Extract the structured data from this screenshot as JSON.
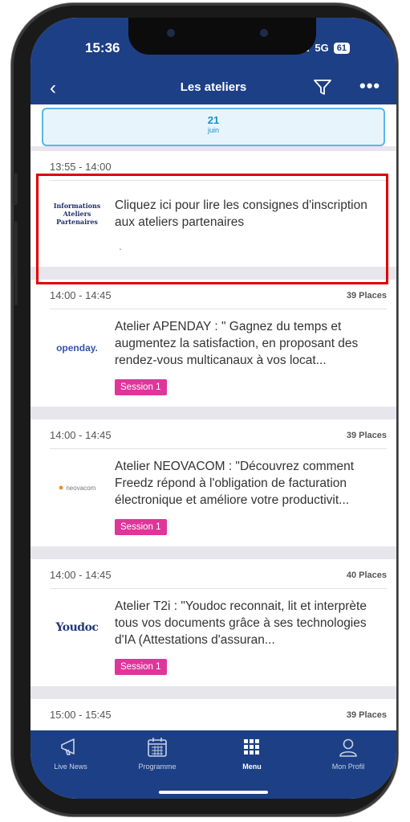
{
  "status": {
    "time": "15:36",
    "network": "5G",
    "battery": "61"
  },
  "nav": {
    "back": "‹",
    "title": "Les ateliers",
    "filter_icon": "filter-icon",
    "more": "•••"
  },
  "date": {
    "day": "21",
    "month": "juin"
  },
  "cards": [
    {
      "time": "13:55 - 14:00",
      "places": "",
      "logo": [
        "Informations",
        "Ateliers",
        "Partenaires"
      ],
      "text": "Cliquez ici pour lire les consignes d'inscription aux ateliers partenaires",
      "extra": ".",
      "badge": ""
    },
    {
      "time": "14:00 - 14:45",
      "places": "39 Places",
      "logo": [
        "openday."
      ],
      "text": "Atelier APENDAY : \" Gagnez du temps et augmentez la satisfaction, en proposant des rendez-vous multicanaux à vos locat...",
      "badge": "Session 1"
    },
    {
      "time": "14:00 - 14:45",
      "places": "39 Places",
      "logo": [
        "neovacom"
      ],
      "text": "Atelier NEOVACOM : \"Découvrez comment Freedz répond à l'obligation de facturation électronique et améliore votre productivit...",
      "badge": "Session 1"
    },
    {
      "time": "14:00 - 14:45",
      "places": "40 Places",
      "logo": [
        "Youdoc"
      ],
      "text": "Atelier T2i : \"Youdoc reconnait, lit et interprète tous vos documents grâce à ses technologies d'IA (Attestations d'assuran...",
      "badge": "Session 1"
    },
    {
      "time": "15:00 - 15:45",
      "places": "39 Places"
    }
  ],
  "tabs": [
    {
      "label": "Live News",
      "icon": "megaphone-icon",
      "active": false
    },
    {
      "label": "Programme",
      "icon": "calendar-icon",
      "active": false
    },
    {
      "label": "Menu",
      "icon": "grid-icon",
      "active": true
    },
    {
      "label": "Mon Profil",
      "icon": "user-icon",
      "active": false
    }
  ],
  "colors": {
    "header": "#1d3f86",
    "accent": "#1e8fc9",
    "badge": "#e0359a",
    "highlight": "#e10000"
  }
}
